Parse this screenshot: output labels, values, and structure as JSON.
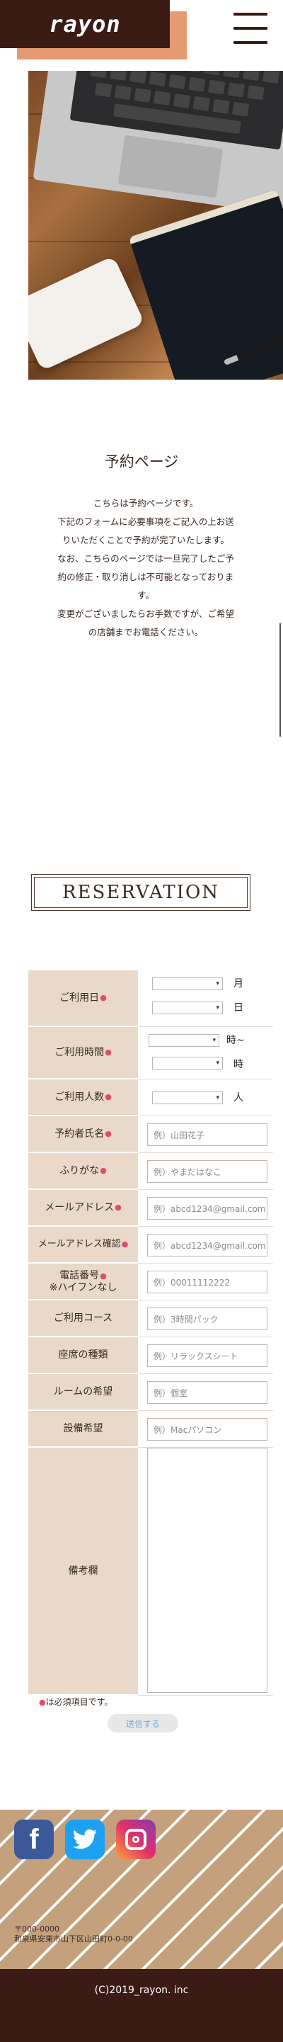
{
  "header": {
    "logo": "rayon"
  },
  "intro": {
    "title": "予約ページ",
    "lines": [
      "こちらは予約ページです。",
      "下記のフォームに必要事項をご記入の上お送",
      "りいただくことで予約が完了いたします。",
      "なお、こちらのページでは一旦完了したご予",
      "約の修正・取り消しは不可能となっておりま",
      "す。",
      "変更がございましたらお手数ですが、ご希望",
      "の店舗までお電話ください。"
    ]
  },
  "reservation": {
    "heading": "RESERVATION"
  },
  "form": {
    "date": {
      "label": "ご利用日",
      "month_unit": "月",
      "day_unit": "日"
    },
    "time": {
      "label": "ご利用時間",
      "from_unit": "時~",
      "to_unit": "時"
    },
    "people": {
      "label": "ご利用人数",
      "unit": "人"
    },
    "name": {
      "label": "予約者氏名",
      "placeholder": "例）山田花子"
    },
    "furigana": {
      "label": "ふりがな",
      "placeholder": "例）やまだはなこ"
    },
    "email": {
      "label": "メールアドレス",
      "placeholder": "例）abcd1234@gmail.com"
    },
    "email_confirm": {
      "label": "メールアドレス確認",
      "placeholder": "例）abcd1234@gmail.com"
    },
    "phone": {
      "label_line1": "電話番号",
      "label_line2": "※ハイフンなし",
      "placeholder": "例）00011112222"
    },
    "course": {
      "label": "ご利用コース",
      "placeholder": "例）3時間パック"
    },
    "seat": {
      "label": "座席の種類",
      "placeholder": "例）リラックスシート"
    },
    "room": {
      "label": "ルームの希望",
      "placeholder": "例）個室"
    },
    "equipment": {
      "label": "設備希望",
      "placeholder": "例）Macパソコン"
    },
    "remarks": {
      "label": "備考欄"
    },
    "required_mark": "●",
    "required_note": "は必須項目です。",
    "submit": "送信する"
  },
  "footer": {
    "postal": "〒000-0000",
    "address": "和泉県安東市山下区山田町0-0-00",
    "copyright": "(C)2019_rayon. inc"
  },
  "colors": {
    "brand_dark": "#3a1c14",
    "accent": "#e59a72",
    "label_bg": "#e8d9c9",
    "required": "#e24a6e"
  }
}
